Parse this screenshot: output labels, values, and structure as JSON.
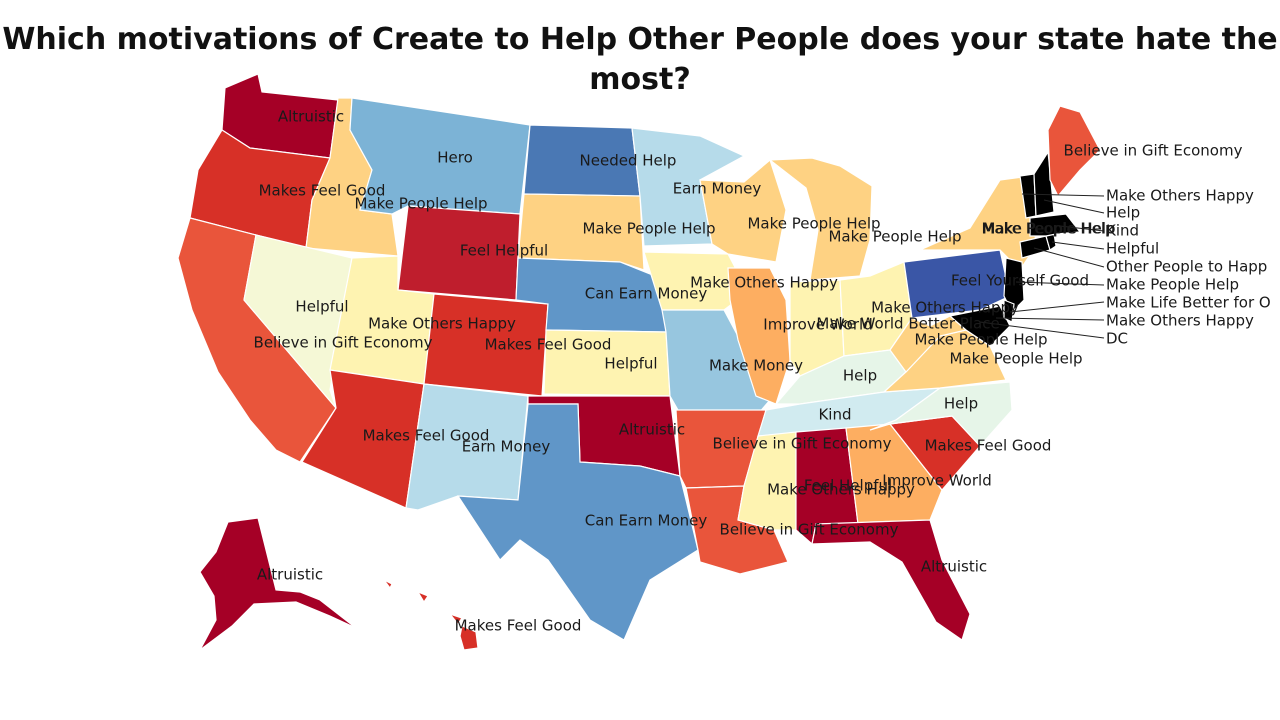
{
  "title": "Which motivations of Create to Help Other People does your state hate the most?",
  "colors": {
    "dark_red": "#a50026",
    "red": "#d73027",
    "orange_red": "#e9553b",
    "orange": "#fdae61",
    "light_orange": "#fed283",
    "pale_yellow": "#fef3b1",
    "cream": "#f5f8d6",
    "pale_blue": "#e6f5e8",
    "light_blue": "#b6dbea",
    "sky_blue": "#97c6df",
    "blue": "#7cb3d6",
    "mid_blue": "#6096c8",
    "steel_blue": "#4a78b4",
    "dark_blue": "#3a56a6"
  },
  "states": [
    {
      "id": "WA",
      "label": "Altruistic",
      "color": "#a50026"
    },
    {
      "id": "OR",
      "label": "Makes Feel Good",
      "color": "#d73027"
    },
    {
      "id": "CA",
      "label": "",
      "color": "#e9553b"
    },
    {
      "id": "ID",
      "label": "Make People Help",
      "color": "#fed283"
    },
    {
      "id": "NV",
      "label": "Helpful",
      "color": "#f5f8d6"
    },
    {
      "id": "MT",
      "label": "Hero",
      "color": "#7cb3d6"
    },
    {
      "id": "WY",
      "label": "Feel Helpful",
      "color": "#bf1e2d"
    },
    {
      "id": "UT",
      "label": "Make Others Happy",
      "color": "#fef3b1"
    },
    {
      "id": "CO",
      "label": "Makes Feel Good",
      "color": "#d73027"
    },
    {
      "id": "AZ",
      "label": "Makes Feel Good",
      "color": "#d73027"
    },
    {
      "id": "NM",
      "label": "Earn Money",
      "color": "#b6dbea"
    },
    {
      "id": "ND",
      "label": "Needed Help",
      "color": "#4a78b4"
    },
    {
      "id": "SD",
      "label": "Make People Help",
      "color": "#fed283"
    },
    {
      "id": "NE",
      "label": "Can Earn Money",
      "color": "#6096c8"
    },
    {
      "id": "KS",
      "label": "Helpful",
      "color": "#fef3b1"
    },
    {
      "id": "OK",
      "label": "Altruistic",
      "color": "#a50026"
    },
    {
      "id": "TX",
      "label": "Can Earn Money",
      "color": "#6096c8"
    },
    {
      "id": "MN",
      "label": "Earn Money",
      "color": "#b6dbea"
    },
    {
      "id": "IA",
      "label": "Make Others Happy",
      "color": "#fef3b1"
    },
    {
      "id": "MO",
      "label": "Make Money",
      "color": "#97c6df"
    },
    {
      "id": "AR",
      "label": "Believe in Gift Economy",
      "color": "#e9553b"
    },
    {
      "id": "LA",
      "label": "Believe in Gift Economy",
      "color": "#e9553b"
    },
    {
      "id": "WI",
      "label": "Make People Help",
      "color": "#fed283"
    },
    {
      "id": "IL",
      "label": "Improve World",
      "color": "#fdae61"
    },
    {
      "id": "MI",
      "label": "Make People Help",
      "color": "#fed283"
    },
    {
      "id": "IN",
      "label": "Make World Better Place",
      "color": "#fef3b1"
    },
    {
      "id": "OH",
      "label": "Make Others Happy",
      "color": "#fef3b1"
    },
    {
      "id": "KY",
      "label": "Help",
      "color": "#e6f5e8"
    },
    {
      "id": "TN",
      "label": "Kind",
      "color": "#d1ebf0"
    },
    {
      "id": "MS",
      "label": "Make Others Happy",
      "color": "#fef3b1"
    },
    {
      "id": "AL",
      "label": "Feel Helpful",
      "color": "#a50026"
    },
    {
      "id": "GA",
      "label": "Improve World",
      "color": "#fdae61"
    },
    {
      "id": "FL",
      "label": "Altruistic",
      "color": "#a50026"
    },
    {
      "id": "SC",
      "label": "Makes Feel Good",
      "color": "#d73027"
    },
    {
      "id": "NC",
      "label": "Help",
      "color": "#e6f5e8"
    },
    {
      "id": "VA",
      "label": "Make People Help",
      "color": "#fed283"
    },
    {
      "id": "WV",
      "label": "Make People Help",
      "color": "#fed283"
    },
    {
      "id": "PA",
      "label": "Feel Yourself Good",
      "color": "#3a56a6"
    },
    {
      "id": "NY",
      "label": "Make People Help",
      "color": "#fed283"
    },
    {
      "id": "ME",
      "label": "Believe in Gift Economy",
      "color": "#e9553b"
    },
    {
      "id": "AK",
      "label": "Altruistic",
      "color": "#a50026"
    },
    {
      "id": "HI",
      "label": "Makes Feel Good",
      "color": "#d73027"
    }
  ],
  "callouts": [
    {
      "id": "VT",
      "label": "Make Others Happy"
    },
    {
      "id": "NH",
      "label": "Help"
    },
    {
      "id": "MA",
      "label": "Kind"
    },
    {
      "id": "RI",
      "label": "Helpful"
    },
    {
      "id": "CT",
      "label": "Other People to Happ"
    },
    {
      "id": "NJ",
      "label": "Make People Help"
    },
    {
      "id": "DE",
      "label": "Make Life Better for O"
    },
    {
      "id": "MD",
      "label": "Make Others Happy"
    },
    {
      "id": "DC",
      "label": "DC"
    }
  ],
  "extra_labels": [
    {
      "id": "CA_NV",
      "label": "Believe in Gift Economy"
    },
    {
      "id": "MA_in",
      "label": "Make People Help"
    }
  ]
}
